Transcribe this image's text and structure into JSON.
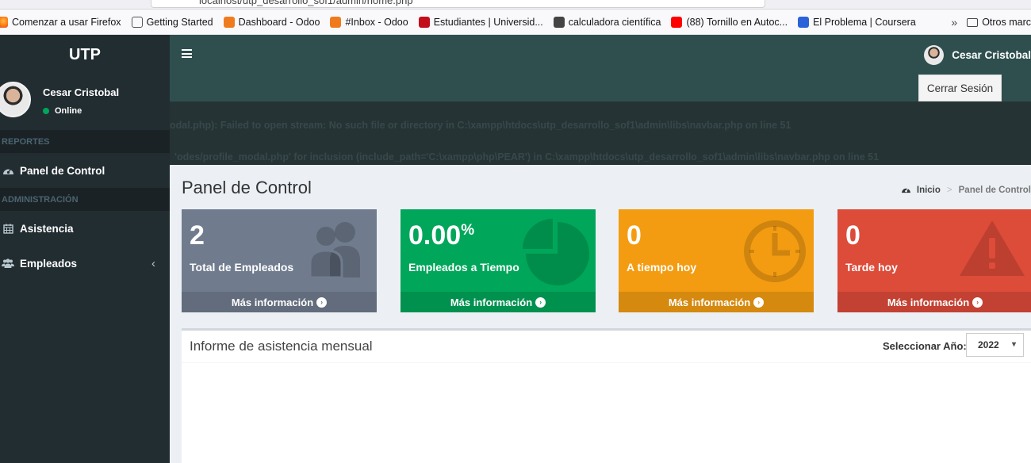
{
  "browser": {
    "url": "localhost/utp_desarrollo_sof1/admin/home.php",
    "bookmarks": [
      {
        "label": "Comenzar a usar Firefox",
        "icon": "firefox-icon"
      },
      {
        "label": "Getting Started",
        "icon": "globe-icon"
      },
      {
        "label": "Dashboard - Odoo",
        "icon": "odoo-icon"
      },
      {
        "label": "#Inbox - Odoo",
        "icon": "odoo-icon"
      },
      {
        "label": "Estudiantes | Universid...",
        "icon": "utp-icon"
      },
      {
        "label": "calculadora científica",
        "icon": "calculator-icon"
      },
      {
        "label": "(88) Tornillo en Autoc...",
        "icon": "youtube-icon"
      },
      {
        "label": "El Problema | Coursera",
        "icon": "coursera-icon"
      }
    ],
    "other_bookmarks": "Otros marc"
  },
  "sidebar": {
    "brand": "UTP",
    "user": {
      "name": "Cesar Cristobal",
      "status": "Online"
    },
    "header_reports": "REPORTES",
    "header_admin": "ADMINISTRACIÓN",
    "items": [
      {
        "label": "Panel de Control",
        "icon": "dashboard-icon"
      },
      {
        "label": "Asistencia",
        "icon": "calendar-icon"
      },
      {
        "label": "Empleados",
        "icon": "users-icon"
      }
    ]
  },
  "navbar": {
    "user_name": "Cesar Cristobal",
    "logout_label": "Cerrar Sesión"
  },
  "errors": {
    "line1": "odal.php): Failed to open stream: No such file or directory in C:\\xampp\\htdocs\\utp_desarrollo_sof1\\admin\\libs\\navbar.php on line 51",
    "line2": "'odes/profile_modal.php' for inclusion (include_path='C:\\xampp\\php\\PEAR') in C:\\xampp\\htdocs\\utp_desarrollo_sof1\\admin\\libs\\navbar.php on line 51"
  },
  "content": {
    "title": "Panel de Control",
    "breadcrumb_home": "Inicio",
    "breadcrumb_active": "Panel de Control",
    "boxes": [
      {
        "value": "2",
        "suffix": "",
        "label": "Total de Empleados",
        "footer": "Más información",
        "color": "#707c8e",
        "icon": "users-icon"
      },
      {
        "value": "0.00",
        "suffix": "%",
        "label": "Empleados a Tiempo",
        "footer": "Más información",
        "color": "#00a65a",
        "icon": "pie-chart-icon"
      },
      {
        "value": "0",
        "suffix": "",
        "label": "A tiempo hoy",
        "footer": "Más información",
        "color": "#f39c12",
        "icon": "clock-icon"
      },
      {
        "value": "0",
        "suffix": "",
        "label": "Tarde hoy",
        "footer": "Más información",
        "color": "#dd4b39",
        "icon": "warning-icon"
      }
    ],
    "report": {
      "title": "Informe de asistencia mensual",
      "year_label": "Seleccionar Año:",
      "year_value": "2022"
    }
  },
  "colors": {
    "sidebar_bg": "#222d32",
    "navbar_bg": "#2f4f4f",
    "content_bg": "#ecf0f5"
  }
}
